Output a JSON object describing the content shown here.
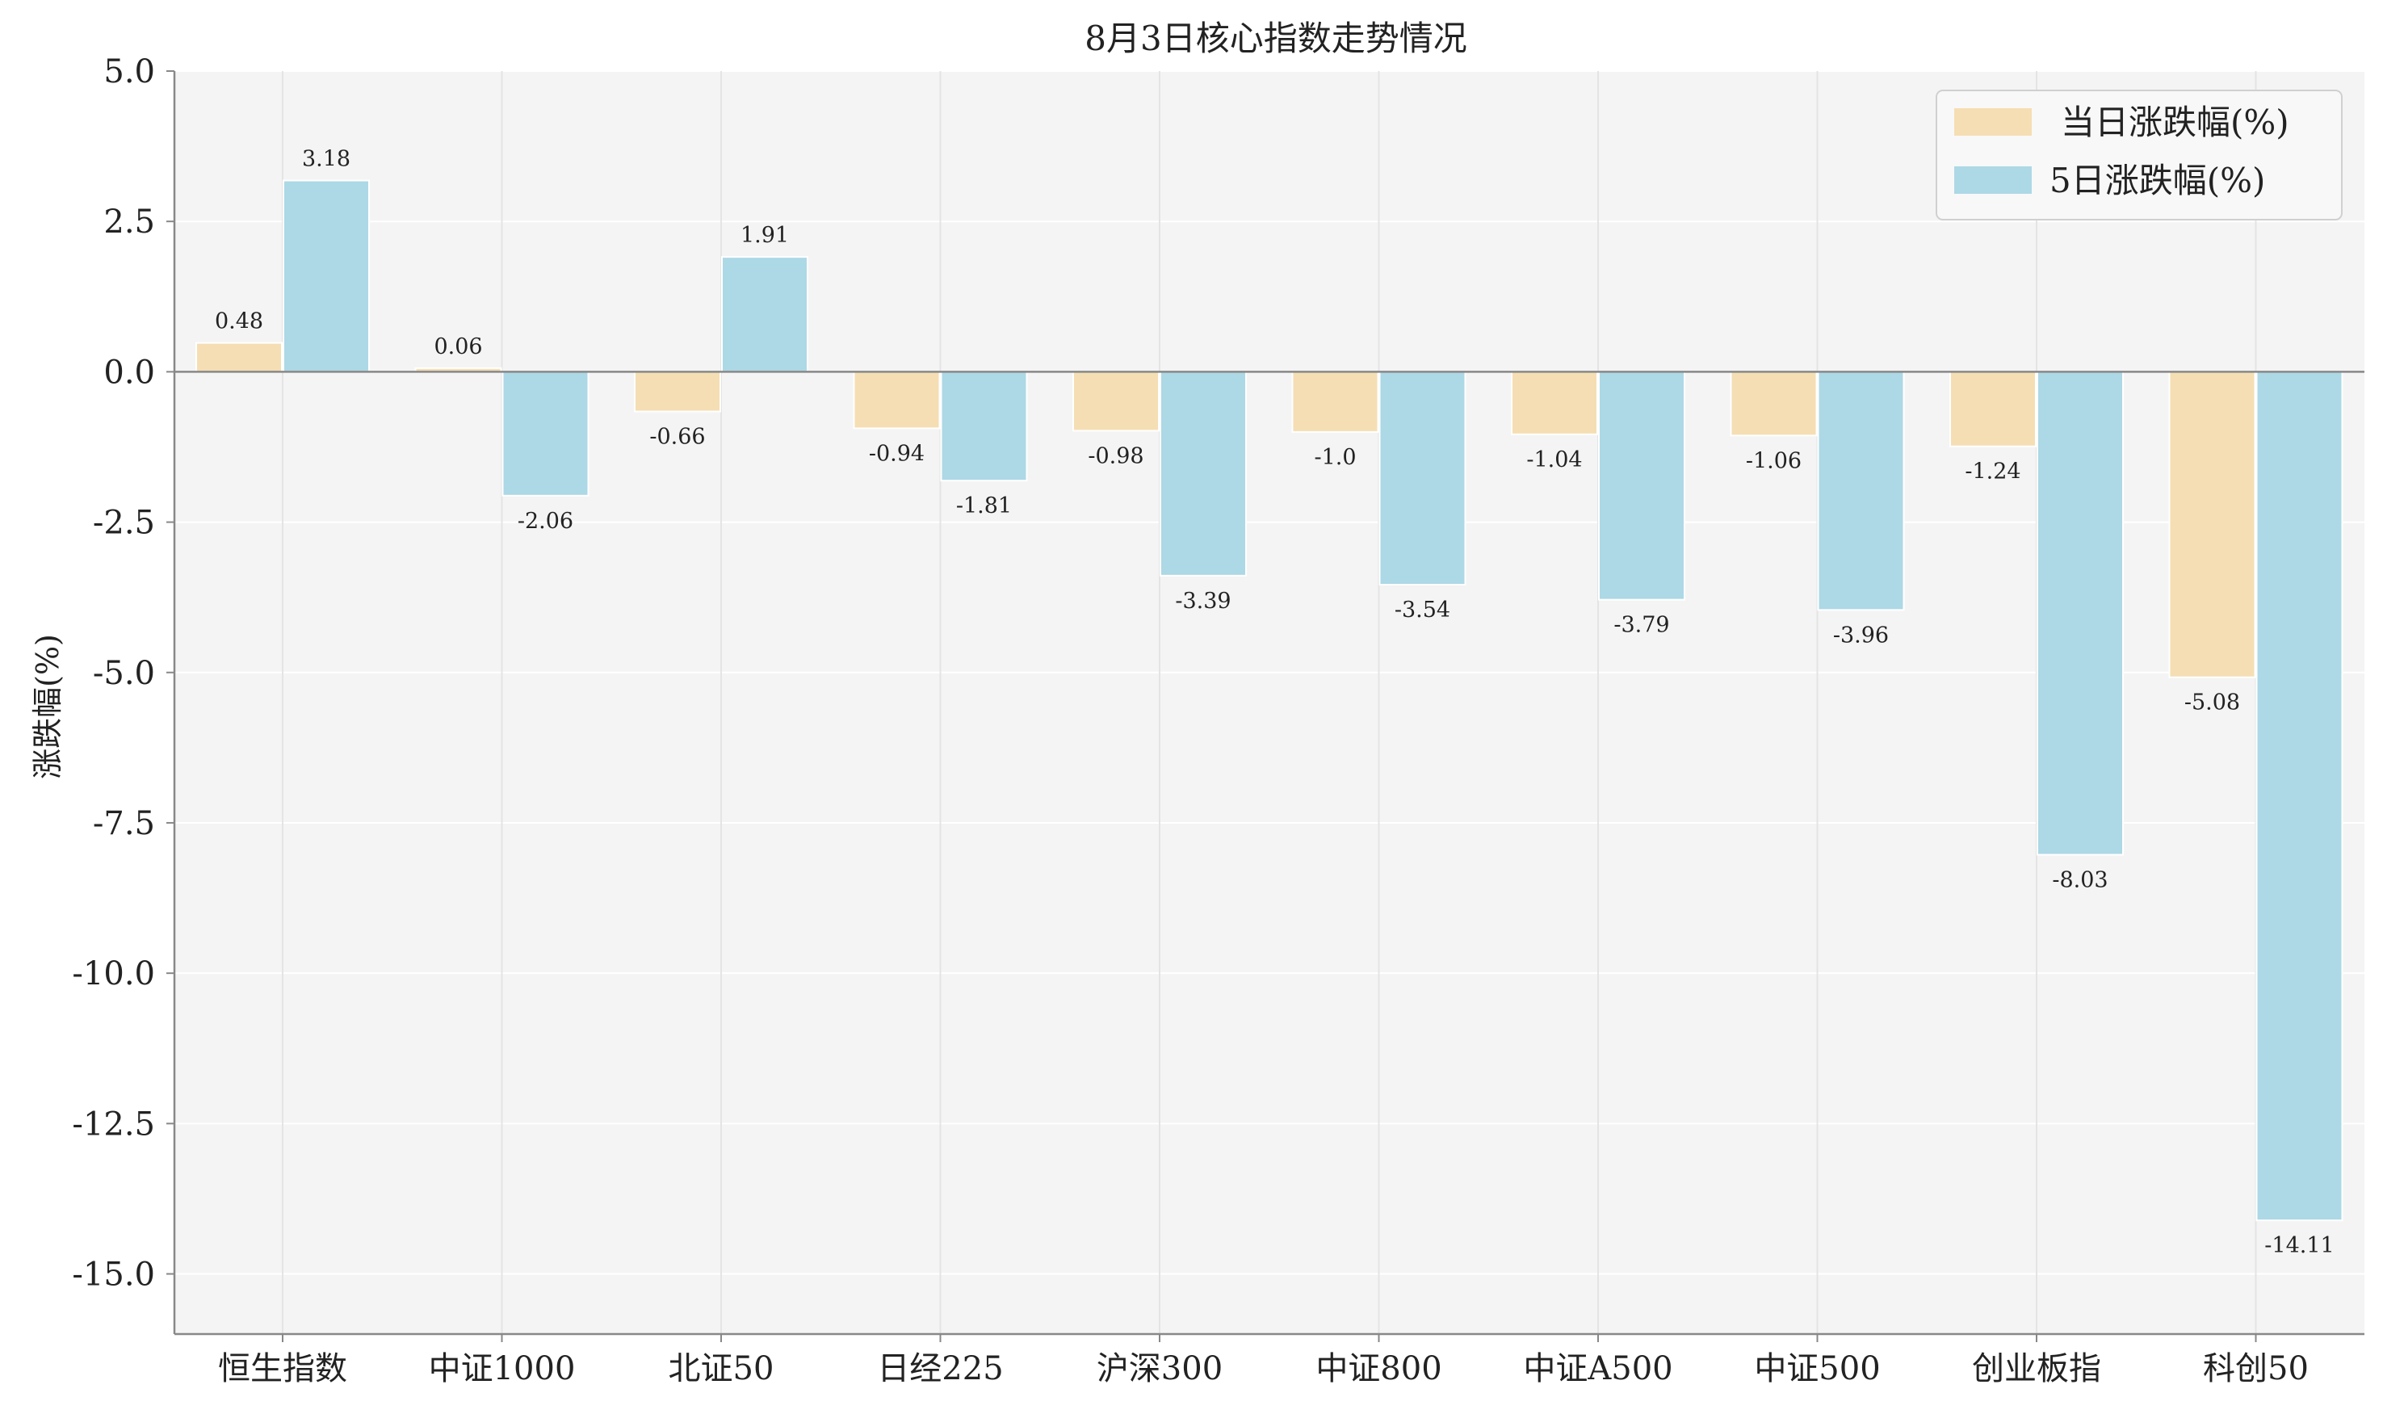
{
  "chart_data": {
    "type": "bar",
    "title": "8月3日核心指数走势情况",
    "xlabel": "",
    "ylabel": "涨跌幅(%)",
    "ylim": [
      -16,
      5
    ],
    "yticks": [
      5.0,
      2.5,
      0.0,
      -2.5,
      -5.0,
      -7.5,
      -10.0,
      -12.5,
      -15.0
    ],
    "ytick_labels": [
      "5.0",
      "2.5",
      "0.0",
      "-2.5",
      "-5.0",
      "-7.5",
      "-10.0",
      "-12.5",
      "-15.0"
    ],
    "grid": true,
    "legend_position": "top-right",
    "categories": [
      "恒生指数",
      "中证1000",
      "北证50",
      "日经225",
      "沪深300",
      "中证800",
      "中证A500",
      "中证500",
      "创业板指",
      "科创50"
    ],
    "series": [
      {
        "name": "当日涨跌幅(%)",
        "color": "#f5deb3",
        "values": [
          0.48,
          0.06,
          -0.66,
          -0.94,
          -0.98,
          -1.0,
          -1.04,
          -1.06,
          -1.24,
          -5.08
        ],
        "labels": [
          "0.48",
          "0.06",
          "-0.66",
          "-0.94",
          "-0.98",
          "-1.0",
          "-1.04",
          "-1.06",
          "-1.24",
          "-5.08"
        ]
      },
      {
        "name": "5日涨跌幅(%)",
        "color": "#add8e6",
        "values": [
          3.18,
          -2.06,
          1.91,
          -1.81,
          -3.39,
          -3.54,
          -3.79,
          -3.96,
          -8.03,
          -14.11
        ],
        "labels": [
          "3.18",
          "-2.06",
          "1.91",
          "-1.81",
          "-3.39",
          "-3.54",
          "-3.79",
          "-3.96",
          "-8.03",
          "-14.11"
        ]
      }
    ],
    "colors": {
      "plot_background": "#f4f4f4",
      "grid": "#e4e4e4",
      "axis": "#888888",
      "zero_line": "#888888"
    }
  }
}
